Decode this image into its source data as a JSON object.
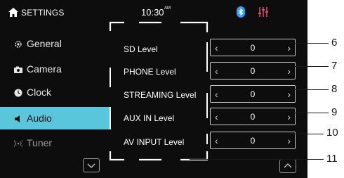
{
  "status_bar": {
    "title": "SETTINGS",
    "time": "10:30",
    "ampm": "AM",
    "icons": [
      "home-icon",
      "bluetooth-icon",
      "equalizer-icon"
    ],
    "bluetooth_color": "#2aa0ff",
    "equalizer_color": "#e0447a"
  },
  "sidebar": {
    "items": [
      {
        "label": "General",
        "icon": "gear-icon"
      },
      {
        "label": "Camera",
        "icon": "camera-icon"
      },
      {
        "label": "Clock",
        "icon": "clock-icon"
      },
      {
        "label": "Audio",
        "icon": "speaker-icon",
        "active": true
      },
      {
        "label": "Tuner",
        "icon": "antenna-icon",
        "dim": true
      }
    ],
    "active_color": "#5ac6dc"
  },
  "levels": [
    {
      "label": "SD Level",
      "value": "0"
    },
    {
      "label": "PHONE Level",
      "value": "0"
    },
    {
      "label": "STREAMING Level",
      "value": "0"
    },
    {
      "label": "AUX IN Level",
      "value": "0"
    },
    {
      "label": "AV INPUT Level",
      "value": "0"
    }
  ],
  "callouts": [
    "6",
    "7",
    "8",
    "9",
    "10",
    "11"
  ]
}
